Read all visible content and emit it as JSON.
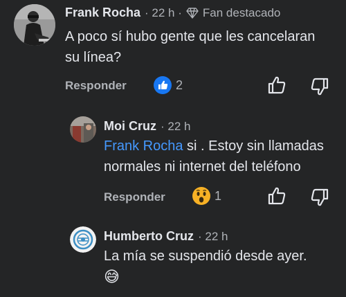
{
  "comments": [
    {
      "author": "Frank Rocha",
      "time": "· 22 h ·",
      "badge": "Fan destacado",
      "text_line1": "A poco sí hubo gente que les cancelaran",
      "text_line2": "su línea?",
      "reply_label": "Responder",
      "reaction_type": "like",
      "reaction_count": "2"
    },
    {
      "author": "Moi Cruz",
      "time": "· 22 h",
      "mention": "Frank Rocha",
      "text_after_mention": " si . Estoy sin llamadas",
      "text_line2": "normales ni internet del teléfono",
      "reply_label": "Responder",
      "reaction_type": "wow",
      "reaction_count": "1"
    },
    {
      "author": "Humberto Cruz",
      "time": "· 22 h",
      "text_line1": "La mía se suspendió desde ayer.",
      "emoji": "😅"
    }
  ],
  "colors": {
    "background": "#242526",
    "primary_text": "#e4e6eb",
    "secondary_text": "#b0b3b8",
    "mention": "#4599ff",
    "like_blue": "#1877f2",
    "wow_yellow": "#f7b125"
  }
}
